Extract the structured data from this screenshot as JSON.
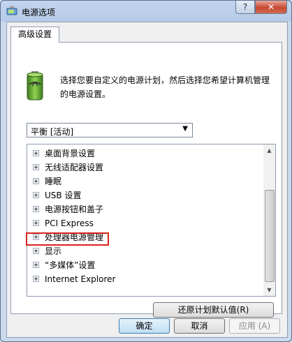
{
  "window": {
    "title": "电源选项",
    "help_label": "?",
    "close_label": "✕"
  },
  "tab": {
    "label": "高级设置"
  },
  "description": "选择您要自定义的电源计划，然后选择您希望计算机管理的电源设置。",
  "plan_select": {
    "value": "平衡 [活动]"
  },
  "tree": {
    "items": [
      {
        "label": "桌面背景设置"
      },
      {
        "label": "无线适配器设置"
      },
      {
        "label": "睡眠"
      },
      {
        "label": "USB 设置"
      },
      {
        "label": "电源按钮和盖子"
      },
      {
        "label": "PCI Express"
      },
      {
        "label": "处理器电源管理"
      },
      {
        "label": "显示"
      },
      {
        "label": "“多媒体”设置"
      },
      {
        "label": "Internet Explorer"
      }
    ]
  },
  "buttons": {
    "restore": "还原计划默认值(R)",
    "ok": "确定",
    "cancel": "取消",
    "apply": "应用 (A)"
  }
}
